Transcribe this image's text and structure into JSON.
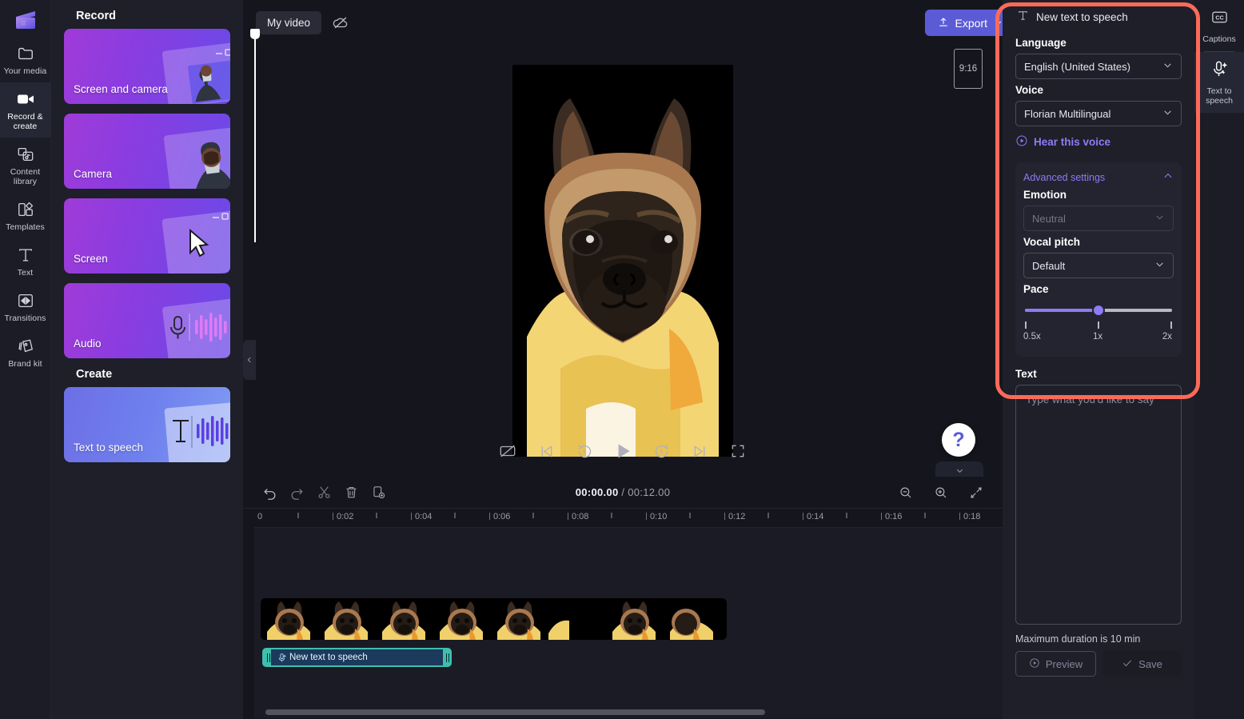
{
  "app": {
    "logo_icon": "clapperboard-icon"
  },
  "sidebar": {
    "items": [
      {
        "label": "Your media",
        "icon": "folder-icon",
        "active": false
      },
      {
        "label": "Record & create",
        "icon": "video-camera-icon",
        "active": true
      },
      {
        "label": "Content library",
        "icon": "media-library-icon",
        "active": false
      },
      {
        "label": "Templates",
        "icon": "templates-icon",
        "active": false
      },
      {
        "label": "Text",
        "icon": "text-t-icon",
        "active": false
      },
      {
        "label": "Transitions",
        "icon": "transitions-icon",
        "active": false
      },
      {
        "label": "Brand kit",
        "icon": "brand-kit-icon",
        "active": false
      }
    ]
  },
  "record_panel": {
    "record_heading": "Record",
    "create_heading": "Create",
    "record_cards": [
      {
        "label": "Screen and camera",
        "art": "screen-and-camera-art"
      },
      {
        "label": "Camera",
        "art": "camera-art"
      },
      {
        "label": "Screen",
        "art": "screen-art"
      },
      {
        "label": "Audio",
        "art": "audio-art"
      }
    ],
    "create_cards": [
      {
        "label": "Text to speech",
        "art": "text-to-speech-art"
      }
    ]
  },
  "topbar": {
    "project_title": "My video",
    "cloud_icon": "cloud-off-icon",
    "export_label": "Export",
    "export_icon": "upload-icon",
    "export_chevron": "chevron-down-icon",
    "export_color": "#5b5bd6"
  },
  "preview": {
    "aspect_ratio": "9:16",
    "help_glyph": "?",
    "collapse_icon": "chevron-left-icon",
    "timeline_collapse_icon": "chevron-down-icon",
    "controls": [
      {
        "name": "captions-off-icon",
        "glyph": "cc-off"
      },
      {
        "name": "skip-previous-icon",
        "glyph": "prev"
      },
      {
        "name": "rewind-5-icon",
        "glyph": "back5"
      },
      {
        "name": "play-icon",
        "glyph": "play"
      },
      {
        "name": "forward-5-icon",
        "glyph": "fwd5"
      },
      {
        "name": "skip-next-icon",
        "glyph": "next"
      },
      {
        "name": "fullscreen-icon",
        "glyph": "fs"
      }
    ]
  },
  "timeline": {
    "tools": [
      {
        "name": "undo-icon"
      },
      {
        "name": "redo-icon"
      },
      {
        "name": "split-scissors-icon"
      },
      {
        "name": "delete-trash-icon"
      },
      {
        "name": "duplicate-icon"
      }
    ],
    "current_time": "00:00.00",
    "time_separator": " / ",
    "total_time": "00:12.00",
    "zoom_out_icon": "zoom-out-icon",
    "zoom_in_icon": "zoom-in-icon",
    "fit_icon": "fit-to-screen-icon",
    "ruler_ticks": [
      "0",
      "0:02",
      "0:04",
      "0:06",
      "0:08",
      "0:10",
      "0:12",
      "0:14",
      "0:16",
      "0:18"
    ],
    "audio_clip_label": "New text to speech",
    "audio_clip_icon": "text-to-speech-icon"
  },
  "tts_panel": {
    "header": "New text to speech",
    "header_icon": "text-t-icon",
    "language_label": "Language",
    "language_value": "English (United States)",
    "voice_label": "Voice",
    "voice_value": "Florian Multilingual",
    "hear_voice_label": "Hear this voice",
    "hear_voice_icon": "play-circle-icon",
    "advanced_label": "Advanced settings",
    "advanced_chevron": "chevron-up-icon",
    "emotion_label": "Emotion",
    "emotion_value": "Neutral",
    "emotion_disabled": true,
    "pitch_label": "Vocal pitch",
    "pitch_value": "Default",
    "pace_label": "Pace",
    "pace_value": 1,
    "pace_ticks": [
      "0.5x",
      "1x",
      "2x"
    ],
    "text_label": "Text",
    "text_value": "",
    "text_placeholder": "Type what you'd like to say",
    "max_duration_note": "Maximum duration is 10 min",
    "preview_label": "Preview",
    "preview_icon": "play-circle-icon",
    "save_label": "Save",
    "save_icon": "check-icon",
    "accent_color": "#8e7bf5",
    "highlight_color": "#fc6a5a"
  },
  "right_tabs": {
    "items": [
      {
        "label": "Captions",
        "icon": "cc-icon",
        "active": false
      },
      {
        "label": "Text to speech",
        "icon": "text-to-speech-icon",
        "active": true
      }
    ]
  }
}
